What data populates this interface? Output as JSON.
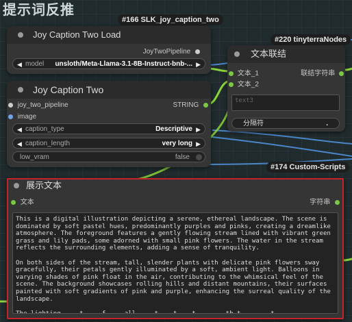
{
  "group_title": "提示词反推",
  "badges": {
    "slk": "#166 SLK_joy_caption_two",
    "tinyterra": "#220 tinyterraNodes",
    "custom_scripts": "#174 Custom-Scripts"
  },
  "joy_load": {
    "title": "Joy Caption Two Load",
    "output": "JoyTwoPipeline",
    "model_label": "model",
    "model_value": "unsloth/Meta-Llama-3.1-8B-Instruct-bnb-..."
  },
  "joy_two": {
    "title": "Joy Caption Two",
    "input_pipeline": "joy_two_pipeline",
    "input_image": "image",
    "output": "STRING",
    "caption_type_label": "caption_type",
    "caption_type_value": "Descriptive",
    "caption_length_label": "caption_length",
    "caption_length_value": "very long",
    "low_vram_label": "low_vram",
    "low_vram_value": "false"
  },
  "concat": {
    "title": "文本联结",
    "input1": "文本_1",
    "input2": "文本_2",
    "output": "联结字符串",
    "text3_placeholder": "text3",
    "separator_label": "分隔符",
    "separator_value": "."
  },
  "show_text": {
    "title": "展示文本",
    "input": "文本",
    "output": "字符串",
    "content": "This is a digital illustration depicting a serene, ethereal landscape. The scene is dominated by soft pastel hues, predominantly purples and pinks, creating a dreamlike atmosphere. The foreground features a gently flowing stream lined with vibrant green grass and lily pads, some adorned with small pink flowers. The water in the stream reflects the surrounding elements, adding a sense of tranquility.\n\nOn both sides of the stream, tall, slender plants with delicate pink flowers sway gracefully, their petals gently illuminated by a soft, ambient light. Balloons in varying shades of pink float in the air, contributing to the whimsical feel of the scene. The background showcases rolling hills and distant mountains, their surfaces painted with soft gradients of pink and purple, enhancing the surreal quality of the landscape.\n\nThe lighting ... t ... f ... all ... t... t... t... ... th t... ... t...",
    "highlight_color": "#c8222a"
  },
  "colors": {
    "wire_green": "#8bd33a",
    "wire_blue": "#5aa0e6",
    "slot_green": "#7ac943"
  }
}
